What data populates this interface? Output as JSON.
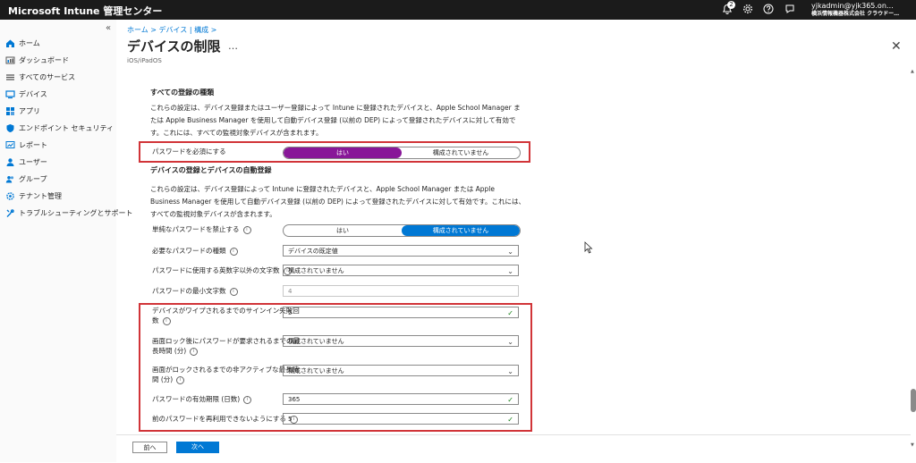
{
  "topbar": {
    "title": "Microsoft Intune 管理センター",
    "notification_count": "2",
    "user_email": "yjkadmin@yjk365.on…",
    "user_org": "横浜情報機器株式会社 クラウドー…"
  },
  "sidebar": {
    "collapse_glyph": "«",
    "items": [
      {
        "label": "ホーム",
        "icon": "home-icon",
        "color": "#0078d4"
      },
      {
        "label": "ダッシュボード",
        "icon": "dashboard-icon",
        "color": "#666666"
      },
      {
        "label": "すべてのサービス",
        "icon": "list-icon",
        "color": "#666666"
      },
      {
        "label": "デバイス",
        "icon": "device-icon",
        "color": "#0078d4"
      },
      {
        "label": "アプリ",
        "icon": "apps-icon",
        "color": "#0078d4"
      },
      {
        "label": "エンドポイント セキュリティ",
        "icon": "shield-icon",
        "color": "#0078d4"
      },
      {
        "label": "レポート",
        "icon": "report-icon",
        "color": "#0078d4"
      },
      {
        "label": "ユーザー",
        "icon": "user-icon",
        "color": "#0078d4"
      },
      {
        "label": "グループ",
        "icon": "group-icon",
        "color": "#0078d4"
      },
      {
        "label": "テナント管理",
        "icon": "tenant-icon",
        "color": "#0078d4"
      },
      {
        "label": "トラブルシューティングとサポート",
        "icon": "wrench-icon",
        "color": "#0078d4"
      }
    ]
  },
  "header": {
    "breadcrumb": "ホーム > デバイス | 構成 >",
    "title": "デバイスの制限",
    "more": "…",
    "subtitle": "iOS/iPadOS",
    "close": "✕"
  },
  "section1": {
    "heading": "すべての登録の種類",
    "description": "これらの設定は、デバイス登録またはユーザー登録によって Intune に登録されたデバイスと、Apple School Manager または Apple Business Manager を使用して自動デバイス登録 (以前の DEP) によって登録されたデバイスに対して有効です。これには、すべての監視対象デバイスが含まれます。",
    "require_password": {
      "label": "パスワードを必須にする",
      "yes": "はい",
      "not_configured": "構成されていません"
    }
  },
  "section2": {
    "heading": "デバイスの登録とデバイスの自動登録",
    "description": "これらの設定は、デバイス登録によって Intune に登録されたデバイスと、Apple School Manager または Apple Business Manager を使用して自動デバイス登録 (以前の DEP) によって登録されたデバイスに対して有効です。これには、すべての監視対象デバイスが含まれます。",
    "simple_password": {
      "label": "単純なパスワードを禁止する",
      "yes": "はい",
      "not_configured": "構成されていません"
    },
    "password_type": {
      "label": "必要なパスワードの種類",
      "value": "デバイスの既定値"
    },
    "non_alnum": {
      "label": "パスワードに使用する英数字以外の文字数",
      "value": "構成されていません"
    },
    "min_length": {
      "label": "パスワードの最小文字数",
      "value": "4"
    },
    "wipe_after": {
      "label1": "デバイスがワイプされるまでのサインイン失敗回",
      "label2": "数",
      "value": "5"
    },
    "lock_timeout": {
      "label1": "画面ロック後にパスワードが要求されるまでの最",
      "label2": "長時間 (分)",
      "value": "構成されていません"
    },
    "inactivity": {
      "label1": "画面がロックされるまでの非アクティブな最長時",
      "label2": "間 (分)",
      "value": "構成されていません"
    },
    "expiration": {
      "label": "パスワードの有効期限 (日数)",
      "value": "365"
    },
    "reuse": {
      "label": "前のパスワードを再利用できないようにする",
      "value": "5"
    }
  },
  "footer": {
    "prev": "前へ",
    "next": "次へ"
  },
  "colors": {
    "accent": "#0078d4",
    "toggle_on": "#881798",
    "highlight": "#d13438"
  }
}
